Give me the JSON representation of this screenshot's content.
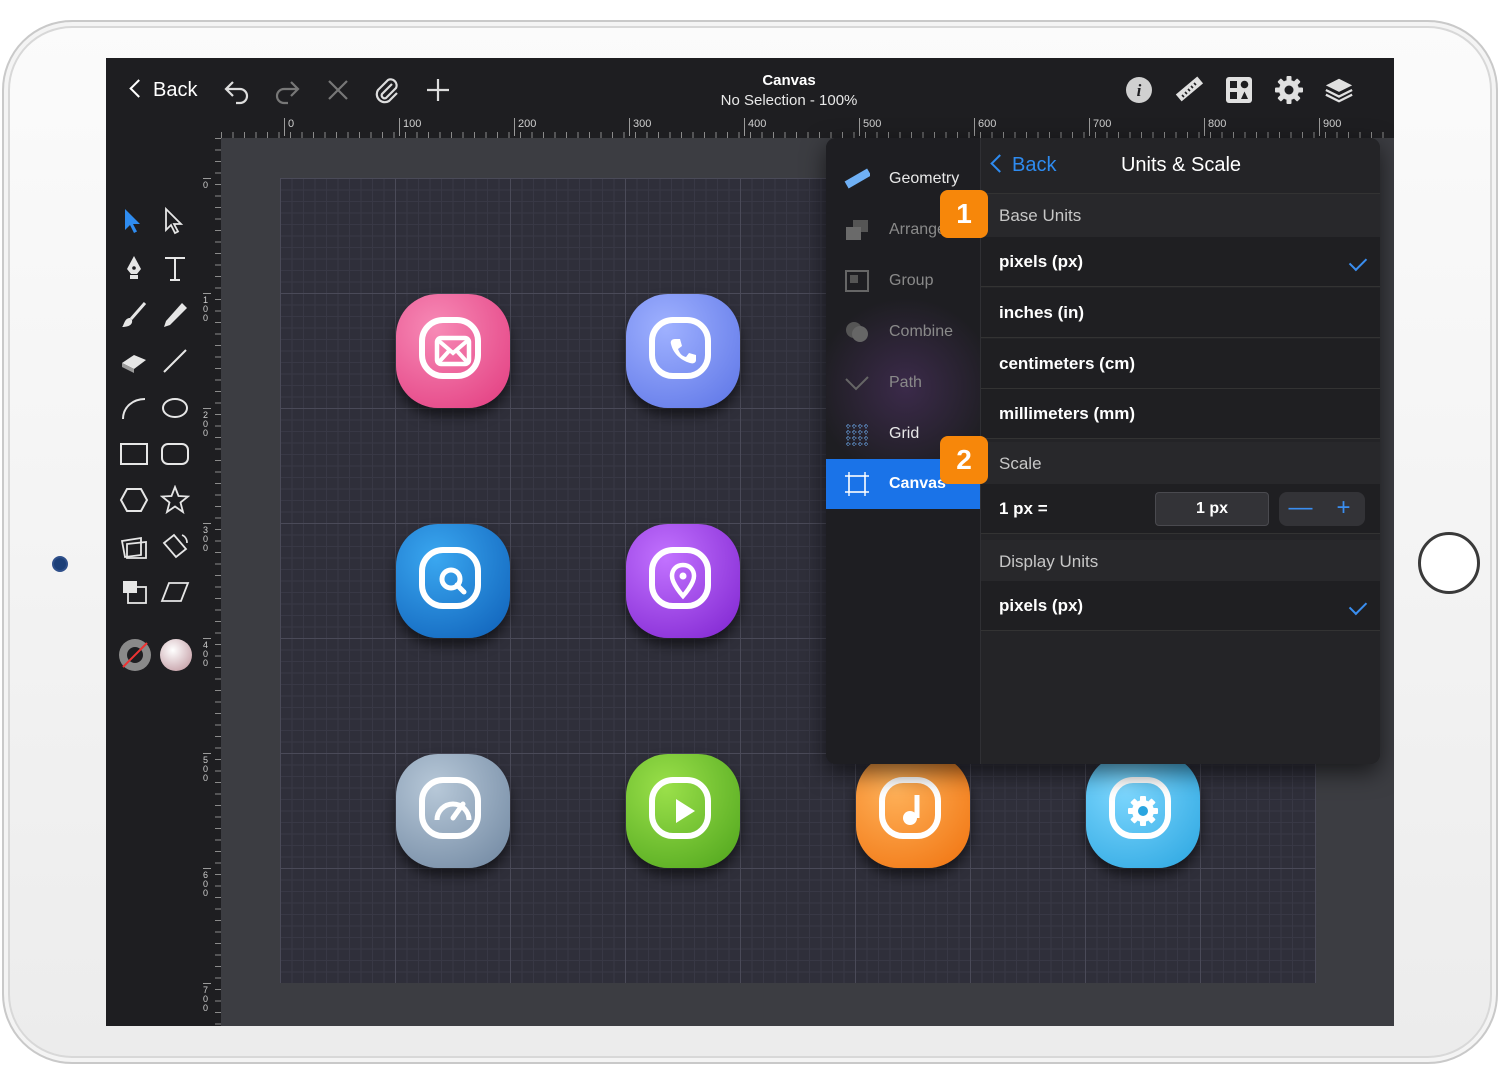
{
  "toolbar": {
    "back_label": "Back",
    "title": "Canvas",
    "subtitle": "No Selection - 100%",
    "icons": [
      "undo-icon",
      "redo-icon",
      "delete-icon",
      "attach-icon",
      "add-icon",
      "info-icon",
      "ruler-icon",
      "library-icon",
      "gear-icon",
      "layers-icon"
    ]
  },
  "ruler": {
    "h_labels": [
      "0",
      "100",
      "200",
      "300",
      "400",
      "500",
      "600",
      "700",
      "800",
      "900"
    ],
    "v_labels": [
      "0",
      "100",
      "200",
      "300",
      "400",
      "500",
      "600",
      "700"
    ]
  },
  "tools": [
    "select-arrow-icon",
    "direct-select-icon",
    "pen-icon",
    "text-icon",
    "brush-icon",
    "pencil-icon",
    "eraser-icon",
    "line-icon",
    "arc-icon",
    "ellipse-icon",
    "rectangle-icon",
    "rounded-rect-icon",
    "hexagon-icon",
    "star-icon",
    "image-icon",
    "transform-icon",
    "frame-icon",
    "skew-icon",
    "stroke-swatch-icon",
    "fill-swatch-icon"
  ],
  "canvas_icons": [
    {
      "name": "mail-app-icon",
      "color": "#ec4a8c"
    },
    {
      "name": "phone-app-icon",
      "color": "#6a84f0"
    },
    {
      "name": "search-app-icon",
      "color": "#1a74d0"
    },
    {
      "name": "location-app-icon",
      "color": "#9b38e0"
    },
    {
      "name": "speed-app-icon",
      "color": "#8aa0b8"
    },
    {
      "name": "play-app-icon",
      "color": "#6cc22c"
    },
    {
      "name": "music-app-icon",
      "color": "#f5861e"
    },
    {
      "name": "settings-app-icon",
      "color": "#3eb8ea"
    }
  ],
  "popover": {
    "side_menu": [
      {
        "label": "Geometry",
        "state": "normal"
      },
      {
        "label": "Arrange",
        "state": "dim"
      },
      {
        "label": "Group",
        "state": "dim"
      },
      {
        "label": "Combine",
        "state": "dim"
      },
      {
        "label": "Path",
        "state": "dim"
      },
      {
        "label": "Grid",
        "state": "normal"
      },
      {
        "label": "Canvas",
        "state": "active"
      }
    ],
    "back_label": "Back",
    "title": "Units & Scale",
    "base_units_header": "Base Units",
    "base_units": [
      {
        "label": "pixels (px)",
        "checked": true
      },
      {
        "label": "inches (in)",
        "checked": false
      },
      {
        "label": "centimeters (cm)",
        "checked": false
      },
      {
        "label": "millimeters (mm)",
        "checked": false
      }
    ],
    "scale_header": "Scale",
    "scale_label": "1 px =",
    "scale_value": "1 px",
    "stepper_minus": "—",
    "stepper_plus": "+",
    "display_units_header": "Display Units",
    "display_units": [
      {
        "label": "pixels (px)",
        "checked": true
      }
    ]
  },
  "badges": [
    "1",
    "2"
  ],
  "colors": {
    "accent": "#1a73e8",
    "badge": "#f7870a"
  }
}
